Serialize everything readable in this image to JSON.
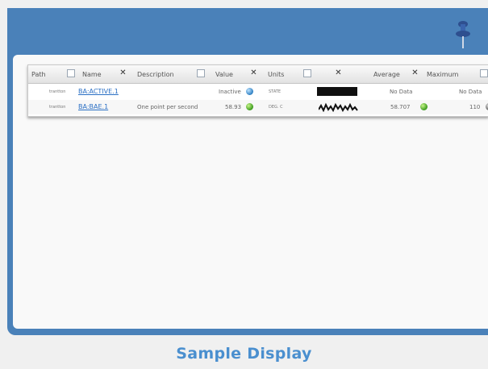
{
  "display": {
    "title": "Sample Display",
    "colors": {
      "frame": "#4a81b9",
      "title": "#4a8fcf",
      "link": "#2a6fc4"
    },
    "pin_icon": "pushpin-icon"
  },
  "table": {
    "columns": [
      "Path",
      "Name",
      "Description",
      "Value",
      "Units",
      "",
      "Average",
      "Maximum"
    ],
    "rows": [
      {
        "path": "trantton",
        "name": "BA:ACTIVE.1",
        "description": "",
        "value": "Inactive",
        "value_status": "blue",
        "units": "STATE",
        "average": "No Data",
        "average_status": "",
        "maximum": "No Data",
        "maximum_status": ""
      },
      {
        "path": "trantton",
        "name": "BA:BAE.1",
        "description": "One point per second",
        "value": "58.93",
        "value_status": "green",
        "units": "DEG. C",
        "average": "58.707",
        "average_status": "green",
        "maximum": "110",
        "maximum_status": "gray"
      }
    ]
  }
}
